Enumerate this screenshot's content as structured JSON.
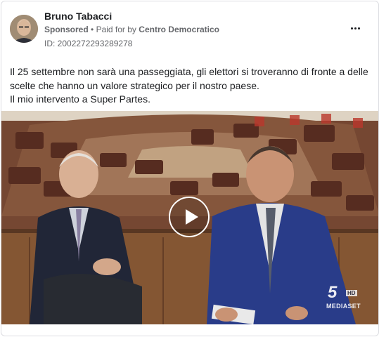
{
  "post": {
    "author": "Bruno Tabacci",
    "sponsored": "Sponsored",
    "separator": "•",
    "paid_for_by": "Paid for by",
    "payer": "Centro Democratico",
    "ad_id": "ID: 2002272293289278",
    "more_icon": "ellipsis-icon",
    "text_lines": [
      "Il 25 settembre non sarà una passeggiata, gli elettori si troveranno di fronte a delle scelte che hanno un valore strategico per il nostro paese.",
      "Il mio intervento a Super Partes."
    ]
  },
  "video": {
    "play_icon": "play-icon",
    "channel_logo_number": "5",
    "channel_logo_hd": "HD",
    "channel_logo_word": "MEDIASET"
  },
  "colors": {
    "text": "#1c1e21",
    "secondary": "#65676b",
    "border": "#dcdde1"
  }
}
